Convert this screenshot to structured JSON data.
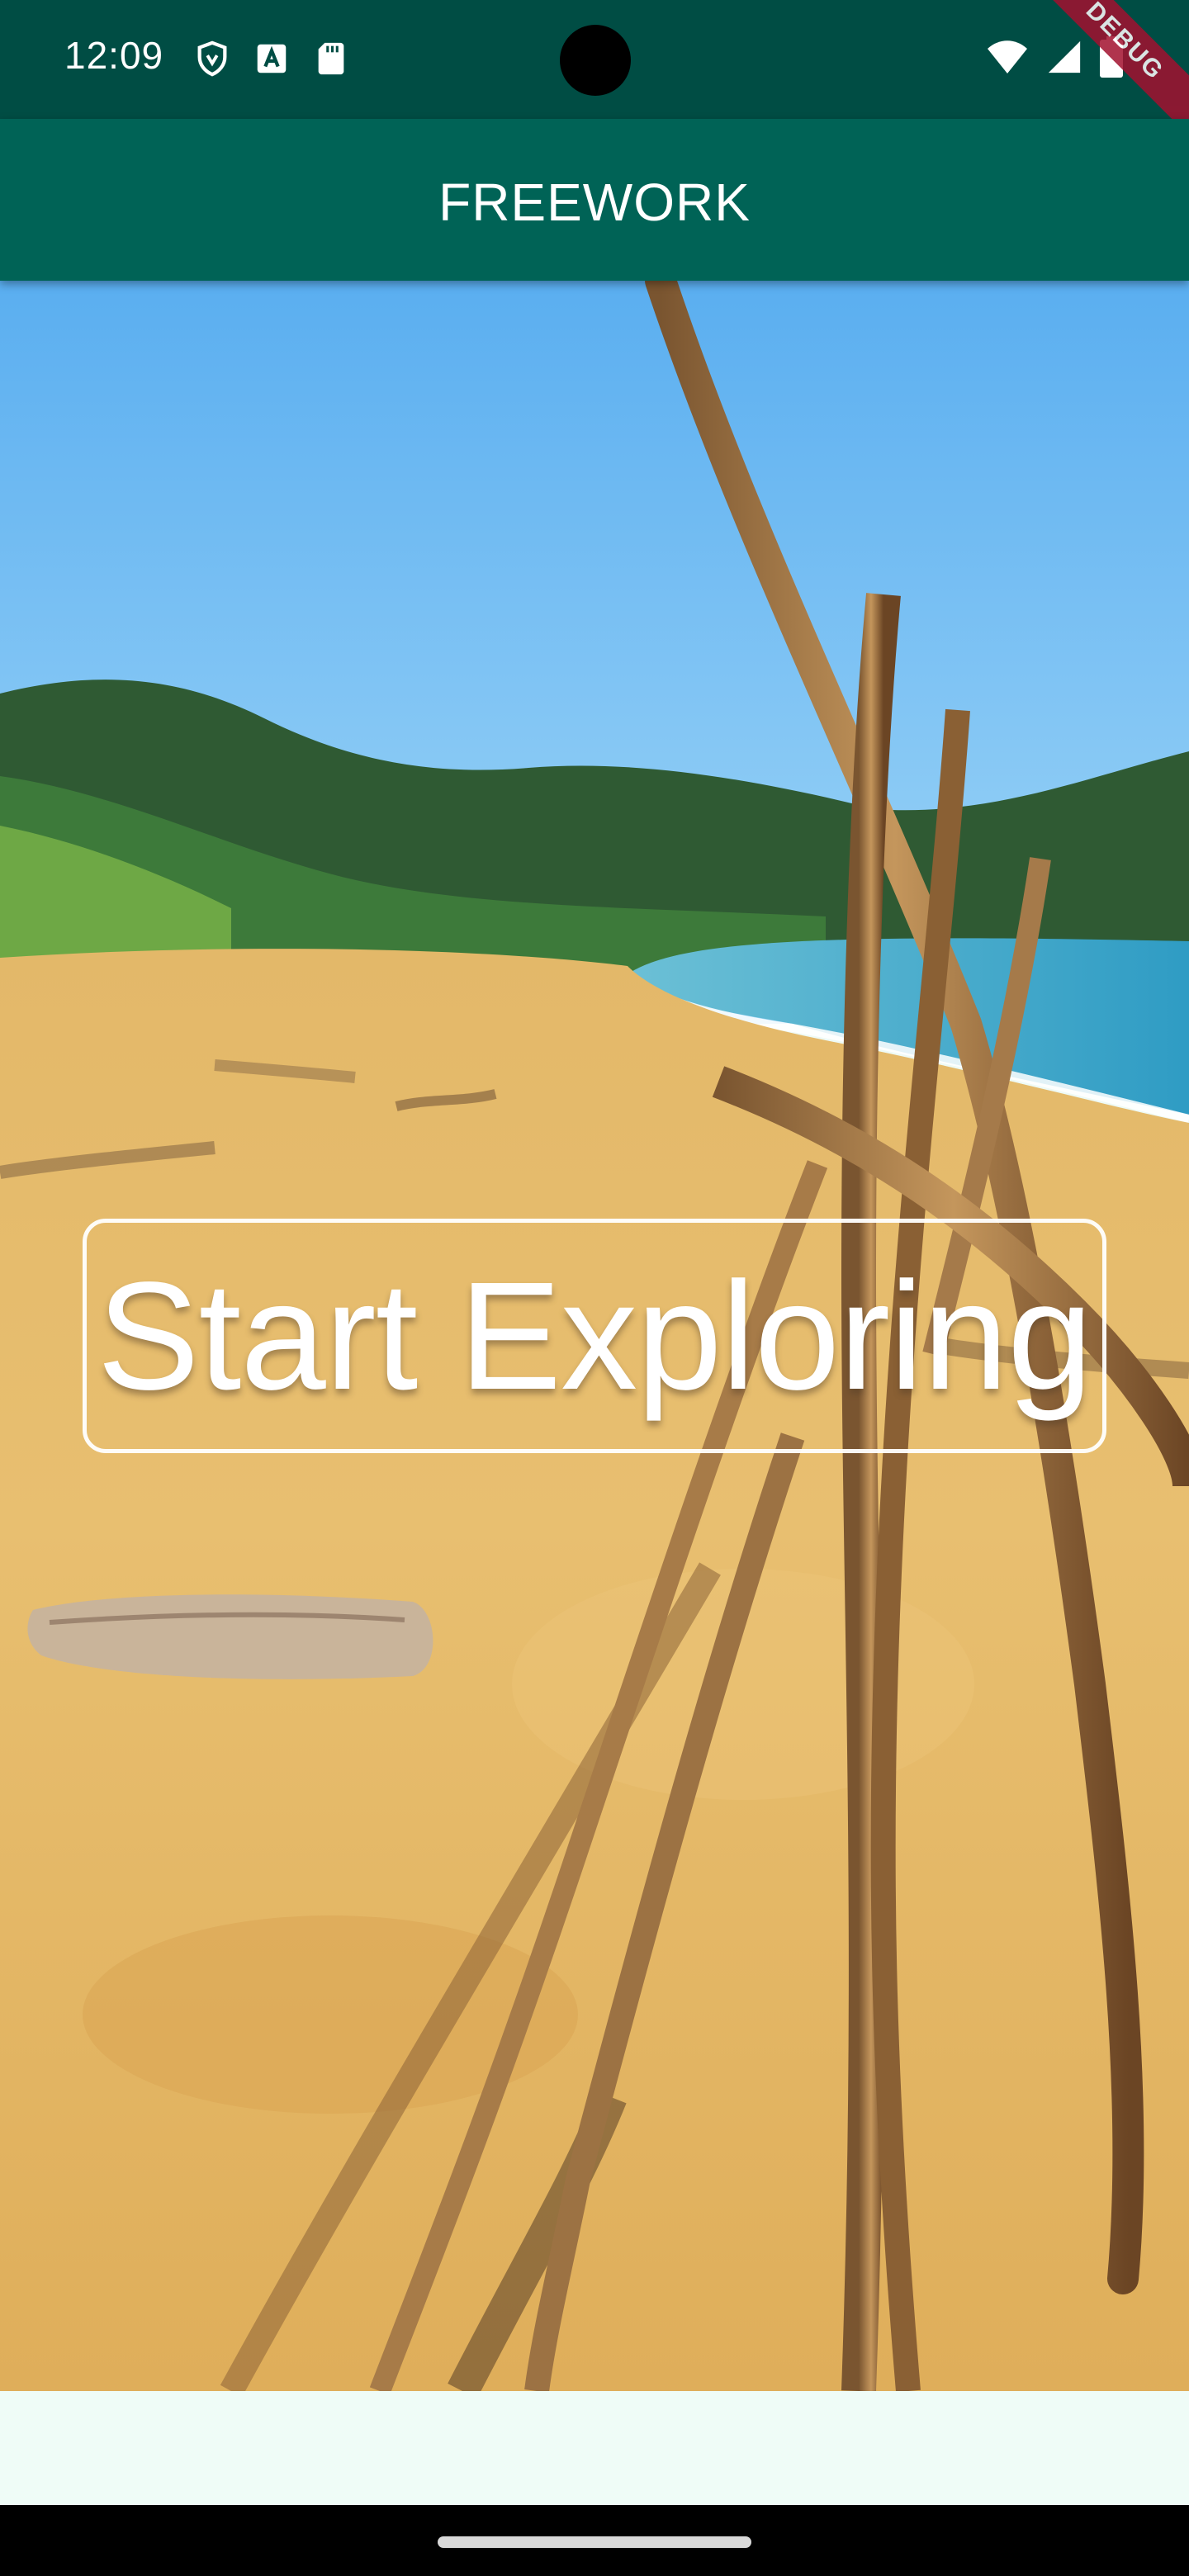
{
  "status_bar": {
    "time": "12:09",
    "left_icons": [
      "vpn-shield-icon",
      "text-a-icon",
      "sd-card-icon"
    ],
    "right_icons": [
      "wifi-icon",
      "signal-icon",
      "battery-icon"
    ],
    "debug_banner": "DEBUG"
  },
  "app_bar": {
    "title": "FREEWORK"
  },
  "hero": {
    "button_label": "Start Exploring"
  },
  "colors": {
    "status_bar": "#004d44",
    "app_bar": "#006356",
    "bottom_area": "#effcf7",
    "debug_banner": "#a3112f"
  }
}
